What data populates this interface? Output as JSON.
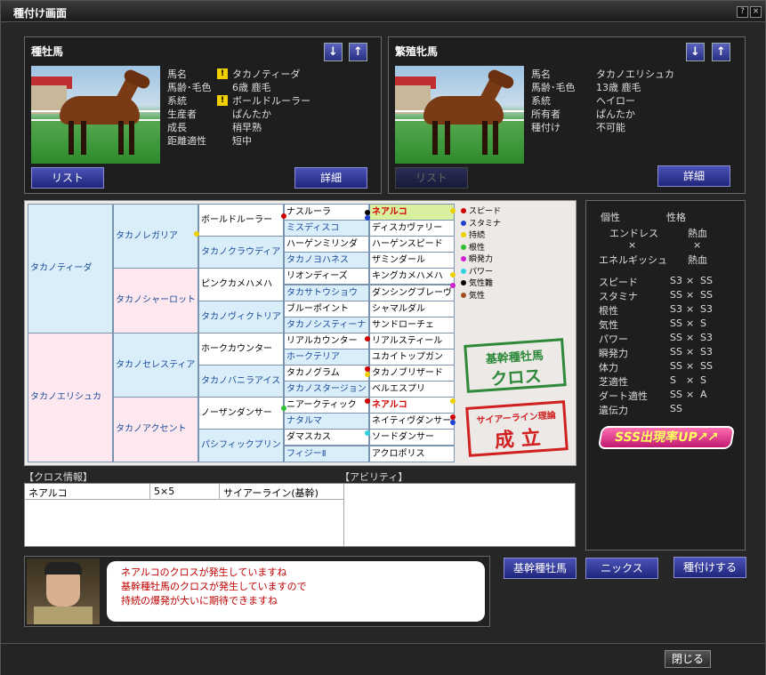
{
  "window": {
    "title": "種付け画面",
    "help": "?",
    "close": "×"
  },
  "stallion": {
    "header": "種牡馬",
    "down": "↓",
    "up": "↑",
    "rows": [
      {
        "k": "馬名",
        "v": "タカノティーダ",
        "warn": true
      },
      {
        "k": "馬齢･毛色",
        "v": "6歳 鹿毛"
      },
      {
        "k": "系統",
        "v": "ボールドルーラー",
        "warn": true
      },
      {
        "k": "生産者",
        "v": "ぱんたか"
      },
      {
        "k": "成長",
        "v": "稍早熟"
      },
      {
        "k": "距離適性",
        "v": "短中"
      }
    ],
    "list": "リスト",
    "detail": "詳細"
  },
  "mare": {
    "header": "繁殖牝馬",
    "down": "↓",
    "up": "↑",
    "rows": [
      {
        "k": "馬名",
        "v": "タカノエリシュカ"
      },
      {
        "k": "馬齢･毛色",
        "v": "13歳 鹿毛"
      },
      {
        "k": "系統",
        "v": "ヘイロー"
      },
      {
        "k": "所有者",
        "v": "ぱんたか"
      },
      {
        "k": "種付け",
        "v": "不可能"
      }
    ],
    "list": "リスト",
    "detail": "詳細"
  },
  "pedigree": {
    "g1": [
      "タカノティーダ",
      "タカノエリシュカ"
    ],
    "g2": [
      "タカノレガリア",
      "タカノシャーロット",
      "タカノセレスティア",
      "タカノアクセント"
    ],
    "g3": [
      "ボールドルーラー",
      "タカノクラウディア",
      "ピンクカメハメハ",
      "タカノヴィクトリア",
      "ホークカウンター",
      "タカノバニラアイス",
      "ノーザンダンサー",
      "パシフィックプリン"
    ],
    "g4": [
      "ナスルーラ",
      "ミスディスコ",
      "ハーゲンミリンダ",
      "タカノヨハネス",
      "リオンディーズ",
      "タカサトウショウ",
      "ブルーポイント",
      "タカノシスティーナ",
      "リアルカウンター",
      "ホークテリア",
      "タカノグラム",
      "タカノスタージョン",
      "ニアークティック",
      "ナタルマ",
      "ダマスカス",
      "フィジーⅡ"
    ],
    "g5": [
      "ネアルコ",
      "ディスカヴァリー",
      "ハーゲンスピード",
      "ザミンダール",
      "キングカメハメハ",
      "ダンシングブレーヴ",
      "シャマルダル",
      "サンドローチェ",
      "リアルスティール",
      "ユカイトップガン",
      "タカノブリザード",
      "ベルエスプリ",
      "ネアルコ",
      "ネイティヴダンサー",
      "ソードダンサー",
      "アクロポリス"
    ],
    "legend": [
      "スピード",
      "スタミナ",
      "持続",
      "根性",
      "瞬発力",
      "パワー",
      "気性難",
      "気性"
    ],
    "stamp1": [
      "基幹種牡馬",
      "クロス"
    ],
    "stamp2": [
      "サイアーライン理論",
      "成 立"
    ]
  },
  "stats": {
    "col1": "個性",
    "col2": "性格",
    "trait1": "エンドレス",
    "trait1b": "熱血",
    "x": "×",
    "trait2": "エネルギッシュ",
    "trait2b": "熱血",
    "rows": [
      [
        "スピード",
        "S3",
        "SS"
      ],
      [
        "スタミナ",
        "SS",
        "SS"
      ],
      [
        "根性",
        "S3",
        "S3"
      ],
      [
        "気性",
        "SS",
        "S"
      ],
      [
        "パワー",
        "SS",
        "S3"
      ],
      [
        "瞬発力",
        "SS",
        "S3"
      ],
      [
        "体力",
        "SS",
        "SS"
      ],
      [
        "芝適性",
        "S",
        "S"
      ],
      [
        "ダート適性",
        "SS",
        "A"
      ],
      [
        "遺伝力",
        "SS",
        ""
      ]
    ],
    "badge": "SSS出現率UP↗↗"
  },
  "cross": {
    "header": "【クロス情報】",
    "ability_header": "【アビリティ】",
    "name": "ネアルコ",
    "ratio": "5×5",
    "type": "サイアーライン(基幹)"
  },
  "dialog": {
    "lines": [
      "ネアルコのクロスが発生していますね",
      "基幹種牡馬のクロスが発生していますので",
      "持続の爆発が大いに期待できますね"
    ]
  },
  "buttons": {
    "kikan": "基幹種牡馬",
    "nicks": "ニックス",
    "tanetsuke": "種付けする",
    "close": "閉じる"
  }
}
